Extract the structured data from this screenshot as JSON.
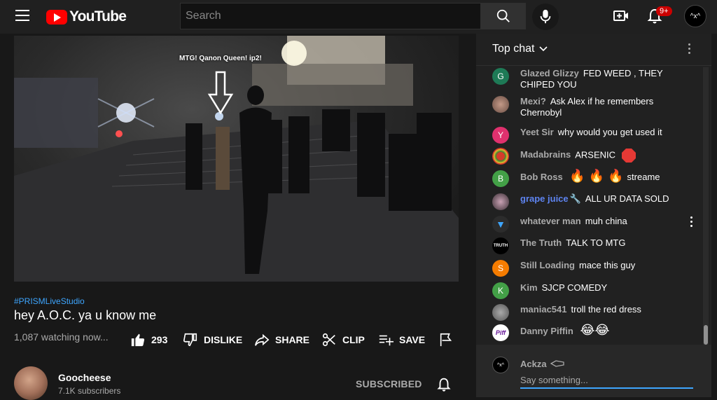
{
  "header": {
    "logo_text": "YouTube",
    "search_placeholder": "Search",
    "notifications_badge": "9+",
    "avatar_text": "^x^"
  },
  "video": {
    "overlay_caption": "MTG! Qanon Queen! ip2!",
    "hashtag": "#PRISMLiveStudio",
    "title": "hey A.O.C. ya u know me",
    "watching": "1,087 watching now...",
    "likes": "293",
    "dislike_label": "DISLIKE",
    "share_label": "SHARE",
    "clip_label": "CLIP",
    "save_label": "SAVE"
  },
  "channel": {
    "name": "Goocheese",
    "subscribers": "7.1K subscribers",
    "subscribed_label": "SUBSCRIBED"
  },
  "chat": {
    "mode_label": "Top chat",
    "messages": [
      {
        "author": "Glazed Glizzy",
        "text": "FED WEED , THEY CHIPED YOU",
        "avatar_letter": "G",
        "avatar_color": "#1e7a56"
      },
      {
        "author": "Mexi?",
        "text": "Ask Alex if he remembers Chernobyl",
        "avatar_letter": "",
        "avatar_color": "#8a6b5e"
      },
      {
        "author": "Yeet Sir",
        "text": "why would you get used it",
        "avatar_letter": "Y",
        "avatar_color": "#e0316e"
      },
      {
        "author": "Madabrains",
        "text": "ARSENIC",
        "avatar_letter": "",
        "avatar_color": "#d43c2a"
      },
      {
        "author": "Bob Ross",
        "text": "streame",
        "avatar_letter": "B",
        "avatar_color": "#43a047"
      },
      {
        "author": "grape juice",
        "text": "ALL UR DATA SOLD",
        "avatar_letter": "",
        "avatar_color": "#5a4a52"
      },
      {
        "author": "whatever man",
        "text": "muh china",
        "avatar_letter": "",
        "avatar_color": "#2c2c2c"
      },
      {
        "author": "The Truth",
        "text": "TALK TO MTG",
        "avatar_letter": "TRUTH",
        "avatar_color": "#000000"
      },
      {
        "author": "Still Loading",
        "text": "mace this guy",
        "avatar_letter": "S",
        "avatar_color": "#f57c00"
      },
      {
        "author": "Kim",
        "text": "SJCP COMEDY",
        "avatar_letter": "K",
        "avatar_color": "#43a047"
      },
      {
        "author": "maniac541",
        "text": "troll the red dress",
        "avatar_letter": "",
        "avatar_color": "#777777"
      },
      {
        "author": "Danny Piffin",
        "text": "",
        "avatar_letter": "Piff",
        "avatar_color": "#ffffff"
      }
    ],
    "me_name": "Ackza",
    "me_avatar_text": "^x^",
    "input_placeholder": "Say something..."
  },
  "colors": {
    "accent": "#3ea6ff",
    "brand": "#ff0000",
    "owner_name": "#5e84f1"
  }
}
